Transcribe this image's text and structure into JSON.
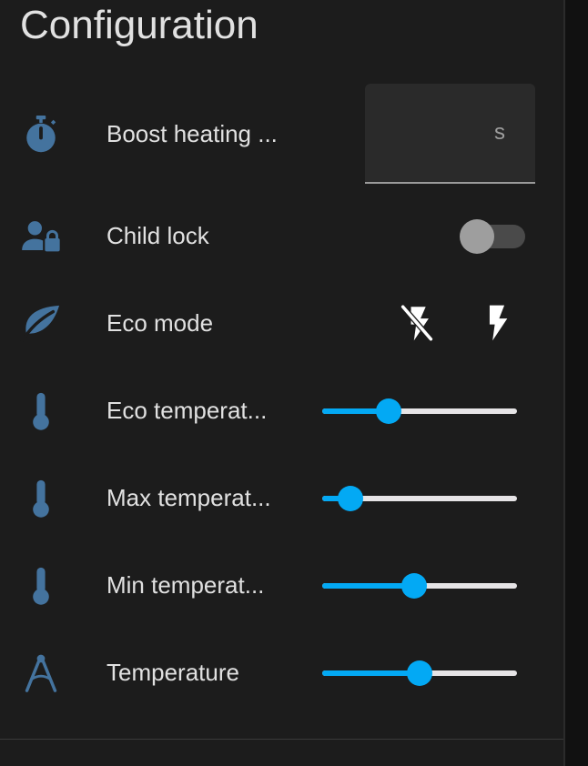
{
  "card": {
    "title": "Configuration"
  },
  "rows": [
    {
      "icon": "timer-icon",
      "label": "Boost heating ...",
      "control": "number-input",
      "value": "",
      "suffix": "s"
    },
    {
      "icon": "account-lock-icon",
      "label": "Child lock",
      "control": "toggle",
      "checked": false
    },
    {
      "icon": "leaf-icon",
      "label": "Eco mode",
      "control": "button-pair",
      "buttons": [
        "flash-off-icon",
        "flash-icon"
      ]
    },
    {
      "icon": "thermometer-icon",
      "label": "Eco temperat...",
      "control": "slider",
      "level": 0.34
    },
    {
      "icon": "thermometer-icon",
      "label": "Max temperat...",
      "control": "slider",
      "level": 0.145
    },
    {
      "icon": "thermometer-icon",
      "label": "Min temperat...",
      "control": "slider",
      "level": 0.47
    },
    {
      "icon": "compass-icon",
      "label": "Temperature",
      "control": "slider",
      "level": 0.5
    }
  ],
  "colors": {
    "icon": "#44739e",
    "accent": "#03a9f4",
    "text": "#e1e1e1",
    "card_background": "#1c1c1c"
  }
}
